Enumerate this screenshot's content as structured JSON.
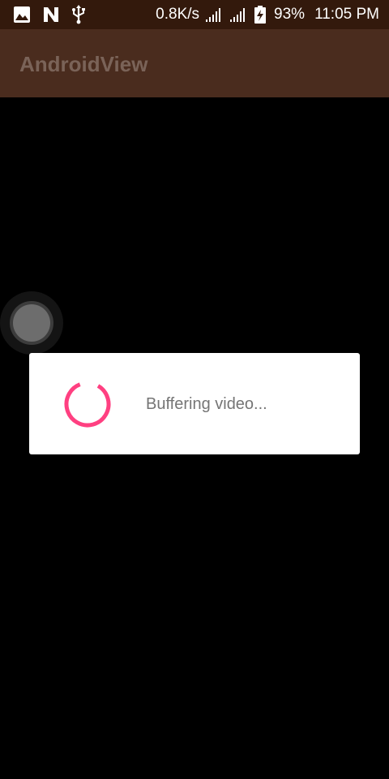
{
  "status_bar": {
    "icons_left": [
      "image-icon",
      "n-logo-icon",
      "usb-icon"
    ],
    "network_speed": "0.8K/s",
    "signal_icons": [
      "signal-1-icon",
      "signal-2-icon"
    ],
    "battery_icon": "battery-charging-icon",
    "battery_percent": "93%",
    "time": "11:05 PM"
  },
  "app_bar": {
    "title": "AndroidView"
  },
  "dialog": {
    "message": "Buffering video...",
    "spinner_color": "#ff4081"
  },
  "colors": {
    "status_bar_bg": "#33190c",
    "app_bar_bg": "#4a2c1e",
    "app_title": "#7a6358",
    "background": "#000000",
    "dialog_bg": "#ffffff",
    "dialog_text": "#757575"
  }
}
